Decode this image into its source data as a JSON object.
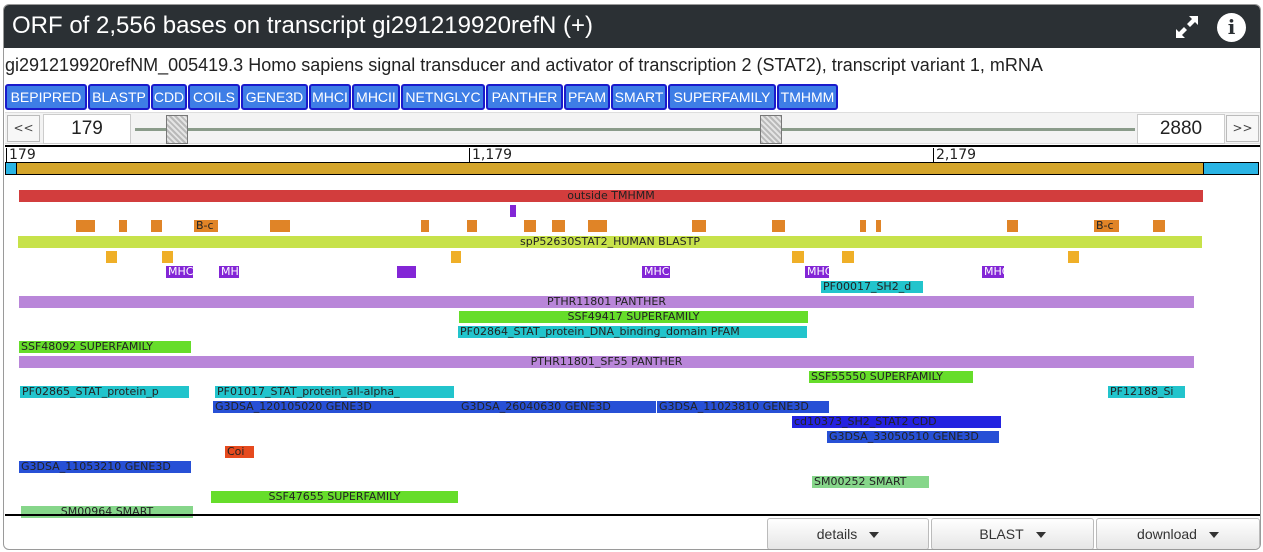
{
  "window": {
    "title": "ORF of 2,556 bases on transcript gi291219920refN (+)"
  },
  "description": "gi291219920refNM_005419.3 Homo sapiens signal transducer and activator of transcription 2 (STAT2), transcript variant 1, mRNA",
  "tools": [
    "BEPIPRED",
    "BLASTP",
    "CDD",
    "COILS",
    "GENE3D",
    "MHCI",
    "MHCII",
    "NETNGLYC",
    "PANTHER",
    "PFAM",
    "SMART",
    "SUPERFAMILY",
    "TMHMM"
  ],
  "range": {
    "start": "179",
    "end": "2880",
    "prev_label": "<<",
    "next_label": ">>"
  },
  "ruler": {
    "ticks": [
      "179",
      "1,179",
      "2,179"
    ]
  },
  "colors": {
    "cds": "#d4a52b",
    "utr": "#2ab4e4",
    "tmhmm": "#d23d3d",
    "bepipred": "#e08427",
    "blastp": "#c7e24a",
    "mhc": "#8326d6",
    "pfam": "#22c4cc",
    "panther": "#b986d9",
    "superfamily": "#66dd2a",
    "gene3d": "#2750d6",
    "cdd": "#2423e0",
    "coils": "#e64a1e",
    "smart": "#86d68a",
    "gold": "#efaf28"
  },
  "features": [
    {
      "label": "outside TMHMM",
      "color": "tmhmm"
    },
    {
      "label": "B-c",
      "color": "bepipred"
    },
    {
      "label": "B-c",
      "color": "bepipred"
    },
    {
      "label": "spP52630STAT2_HUMAN BLASTP",
      "color": "blastp"
    },
    {
      "label": "MHC",
      "color": "mhc"
    },
    {
      "label": "MHC",
      "color": "mhc"
    },
    {
      "label": "MHC",
      "color": "mhc"
    },
    {
      "label": "MHC",
      "color": "mhc"
    },
    {
      "label": "MHC",
      "color": "mhc"
    },
    {
      "label": "PF00017_SH2_d",
      "color": "pfam"
    },
    {
      "label": "PTHR11801 PANTHER",
      "color": "panther"
    },
    {
      "label": "SSF49417 SUPERFAMILY",
      "color": "superfamily"
    },
    {
      "label": "PF02864_STAT_protein_DNA_binding_domain PFAM",
      "color": "pfam"
    },
    {
      "label": "SSF48092 SUPERFAMILY",
      "color": "superfamily"
    },
    {
      "label": "PTHR11801_SF55 PANTHER",
      "color": "panther"
    },
    {
      "label": "SSF55550 SUPERFAMILY",
      "color": "superfamily"
    },
    {
      "label": "PF02865_STAT_protein_p",
      "color": "pfam"
    },
    {
      "label": "PF01017_STAT_protein_all-alpha_",
      "color": "pfam"
    },
    {
      "label": "PF12188_Si",
      "color": "pfam"
    },
    {
      "label": "G3DSA_120105020 GENE3D",
      "color": "gene3d"
    },
    {
      "label": "G3DSA_26040630 GENE3D",
      "color": "gene3d"
    },
    {
      "label": "G3DSA_11023810 GENE3D",
      "color": "gene3d"
    },
    {
      "label": "cd10373_SH2_STAT2 CDD",
      "color": "cdd"
    },
    {
      "label": "G3DSA_33050510 GENE3D",
      "color": "gene3d"
    },
    {
      "label": "Coi",
      "color": "coils"
    },
    {
      "label": "G3DSA_11053210 GENE3D",
      "color": "gene3d"
    },
    {
      "label": "SM00252 SMART",
      "color": "smart"
    },
    {
      "label": "SSF47655 SUPERFAMILY",
      "color": "superfamily"
    },
    {
      "label": "SM00964 SMART",
      "color": "smart"
    }
  ],
  "footer": {
    "details": "details",
    "blast": "BLAST",
    "download": "download"
  }
}
